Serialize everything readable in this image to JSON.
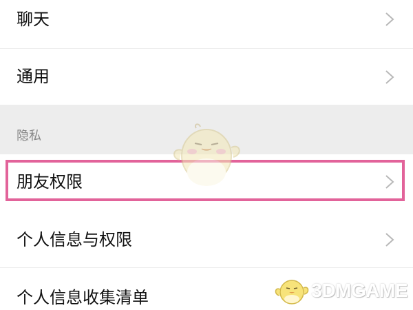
{
  "settings": {
    "items_top": [
      {
        "label": "聊天"
      },
      {
        "label": "通用"
      }
    ],
    "section": {
      "title": "隐私"
    },
    "items_privacy": [
      {
        "label": "朋友权限"
      },
      {
        "label": "个人信息与权限"
      },
      {
        "label": "个人信息收集清单"
      }
    ],
    "highlighted_item": "朋友权限"
  },
  "watermark": {
    "text": "3DMGAME",
    "icon": "duck-mascot-icon"
  },
  "colors": {
    "highlight_border": "#e2639a",
    "section_background": "#ededed",
    "chevron": "#b8b8b8"
  }
}
